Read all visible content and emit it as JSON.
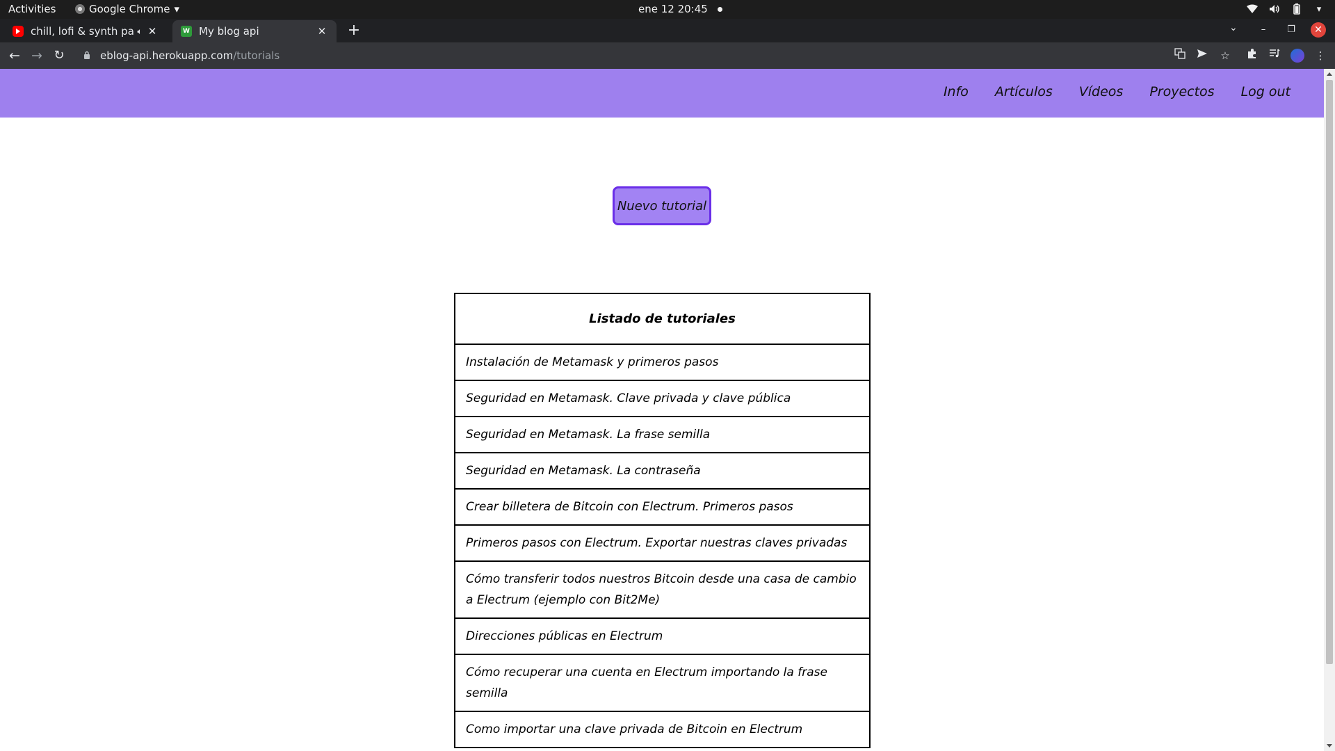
{
  "os_bar": {
    "activities": "Activities",
    "app_name": "Google Chrome",
    "clock": "ene 12  20:45"
  },
  "browser": {
    "tabs": [
      {
        "title": "chill, lofi & synth para p",
        "icon": "youtube-icon",
        "audio": true,
        "active": false
      },
      {
        "title": "My blog api",
        "icon": "site-favicon",
        "audio": false,
        "active": true
      }
    ],
    "url_host": "eblog-api.herokuapp.com",
    "url_path": "/tutorials"
  },
  "site": {
    "nav_color": "#9e80ee",
    "nav_items": [
      "Info",
      "Artículos",
      "Vídeos",
      "Proyectos",
      "Log out"
    ],
    "new_button": "Nuevo tutorial",
    "table_header": "Listado de tutoriales",
    "tutorials": [
      "Instalación de Metamask y primeros pasos",
      "Seguridad en Metamask. Clave privada y clave pública",
      "Seguridad en Metamask. La frase semilla",
      "Seguridad en Metamask. La contraseña",
      "Crear billetera de Bitcoin con Electrum. Primeros pasos",
      "Primeros pasos con Electrum. Exportar nuestras claves privadas",
      "Cómo transferir todos nuestros Bitcoin desde una casa de cambio a Electrum (ejemplo con Bit2Me)",
      "Direcciones públicas en Electrum",
      "Cómo recuperar una cuenta en Electrum importando la frase semilla",
      "Como importar una clave privada de Bitcoin en Electrum"
    ]
  }
}
